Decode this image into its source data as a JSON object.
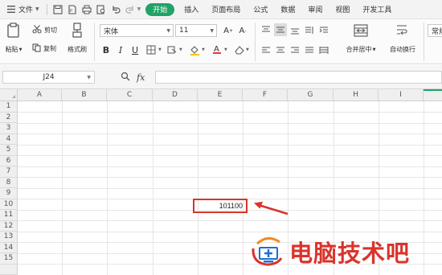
{
  "menubar": {
    "file_label": "文件",
    "tabs": [
      "开始",
      "插入",
      "页面布局",
      "公式",
      "数据",
      "审阅",
      "视图",
      "开发工具"
    ],
    "active_tab": "开始"
  },
  "ribbon": {
    "paste_label": "粘贴",
    "cut_label": "剪切",
    "copy_label": "复制",
    "format_painter_label": "格式刷",
    "font_name": "宋体",
    "font_size": "11",
    "merge_label": "合并居中",
    "wrap_label": "自动换行",
    "style_combo": "常规"
  },
  "formula_bar": {
    "cell_ref": "J24",
    "fx_label": "fx",
    "content": ""
  },
  "columns": [
    "A",
    "B",
    "C",
    "D",
    "E",
    "F",
    "G",
    "H",
    "I"
  ],
  "rows": [
    "1",
    "2",
    "3",
    "4",
    "5",
    "6",
    "7",
    "8",
    "9",
    "10",
    "11",
    "12",
    "13",
    "14",
    "15"
  ],
  "cells": {
    "E10": "101100"
  },
  "annotation": {
    "box_color": "#d9342b",
    "arrow_color": "#d9342b"
  },
  "watermark": {
    "text": "电脑技术吧"
  },
  "colors": {
    "accent": "#21a366",
    "annotation": "#d9342b"
  }
}
